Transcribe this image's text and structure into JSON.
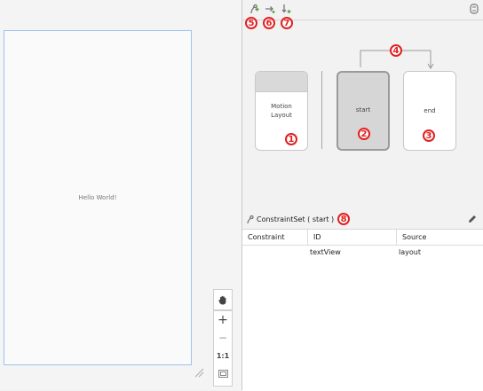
{
  "canvas": {
    "preview_text": "Hello World!"
  },
  "zoom_toolbar": {
    "zoom_in": "+",
    "zoom_out": "−",
    "actual_size": "1:1"
  },
  "toolbar": {
    "markers": [
      "5",
      "6",
      "7"
    ]
  },
  "overview": {
    "cards": [
      {
        "label": "Motion\nLayout",
        "marker": "1",
        "selected": false
      },
      {
        "label": "start",
        "marker": "2",
        "selected": true
      },
      {
        "label": "end",
        "marker": "3",
        "selected": false
      }
    ],
    "transition_marker": "4"
  },
  "constraint_set": {
    "title": "ConstraintSet ( start )",
    "marker": "8",
    "columns": [
      "Constraint",
      "ID",
      "Source"
    ],
    "rows": [
      {
        "constraint": "",
        "id": "textView",
        "source": "layout"
      }
    ]
  },
  "colors": {
    "accent_red": "#e02020",
    "selection_blue": "#9dc3ee",
    "selected_card": "#d6d6d6"
  }
}
